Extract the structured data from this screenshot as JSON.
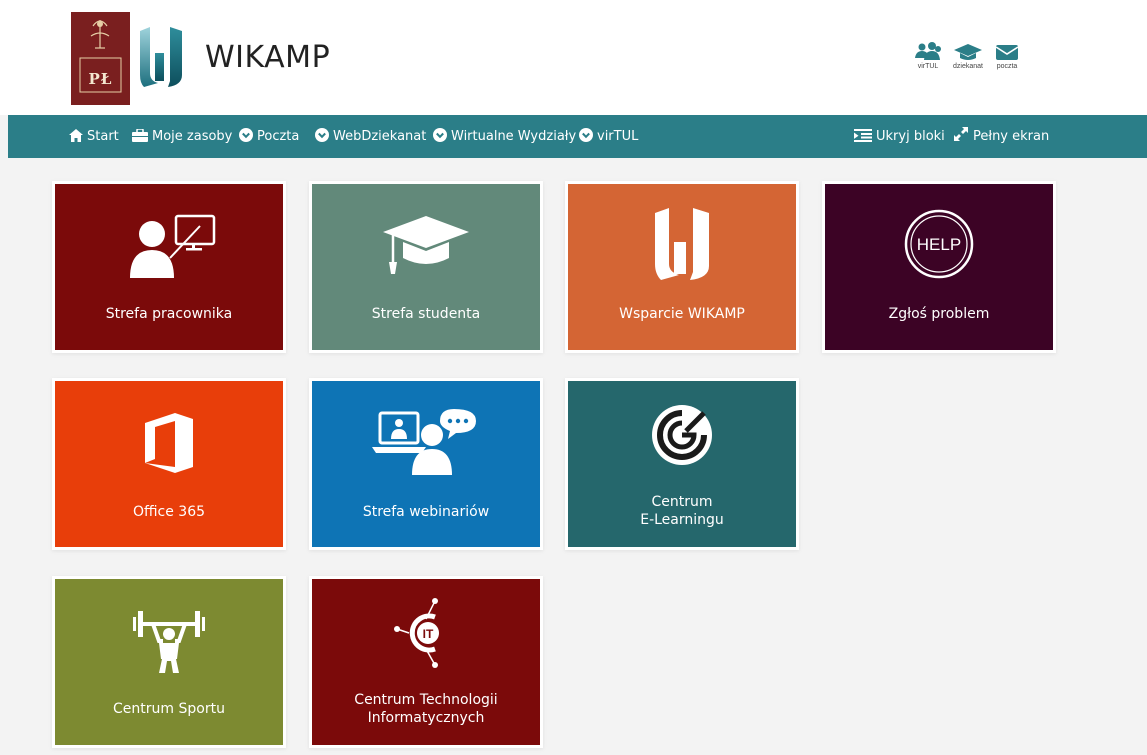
{
  "header": {
    "logo_text": "PŁ",
    "site_title": "WIKAMP",
    "quick_links": [
      {
        "label": "virTUL",
        "icon": "users-icon"
      },
      {
        "label": "dziekanat",
        "icon": "graduation-cap-icon"
      },
      {
        "label": "poczta",
        "icon": "envelope-icon"
      }
    ]
  },
  "nav": {
    "items": [
      {
        "label": "Start",
        "icon": "home-icon"
      },
      {
        "label": "Moje zasoby",
        "icon": "briefcase-icon"
      },
      {
        "label": "Poczta",
        "icon": "chevron-down-circle-icon"
      },
      {
        "label": "WebDziekanat",
        "icon": "chevron-down-circle-icon"
      },
      {
        "label": "Wirtualne Wydziały",
        "icon": "chevron-down-circle-icon"
      },
      {
        "label": "virTUL",
        "icon": "chevron-down-circle-icon"
      }
    ],
    "right": [
      {
        "label": "Ukryj bloki",
        "icon": "indent-icon"
      },
      {
        "label": "Pełny ekran",
        "icon": "expand-icon"
      }
    ]
  },
  "tiles": [
    {
      "label": "Strefa pracownika",
      "color": "#7b0a0a",
      "icon": "teacher-board-icon"
    },
    {
      "label": "Strefa studenta",
      "color": "#62897a",
      "icon": "graduation-cap-icon"
    },
    {
      "label": "Wsparcie WIKAMP",
      "color": "#d46534",
      "icon": "wikamp-logo-icon"
    },
    {
      "label": "Zgłoś problem",
      "color": "#3c0325",
      "icon": "help-icon",
      "icon_text": "HELP"
    },
    {
      "label": "Office 365",
      "color": "#e83e0a",
      "icon": "office-icon"
    },
    {
      "label": "Strefa webinariów",
      "color": "#0e74b5",
      "icon": "webinar-icon"
    },
    {
      "label_lines": [
        "Centrum",
        "E-Learningu"
      ],
      "color": "#25676c",
      "icon": "elearning-logo-icon"
    },
    {
      "label": "Centrum Sportu",
      "color": "#7d8a31",
      "icon": "weightlifter-icon"
    },
    {
      "label_lines": [
        "Centrum Technologii",
        "Informatycznych"
      ],
      "color": "#7b0a0a",
      "icon": "it-logo-icon",
      "icon_text": "IT"
    }
  ]
}
